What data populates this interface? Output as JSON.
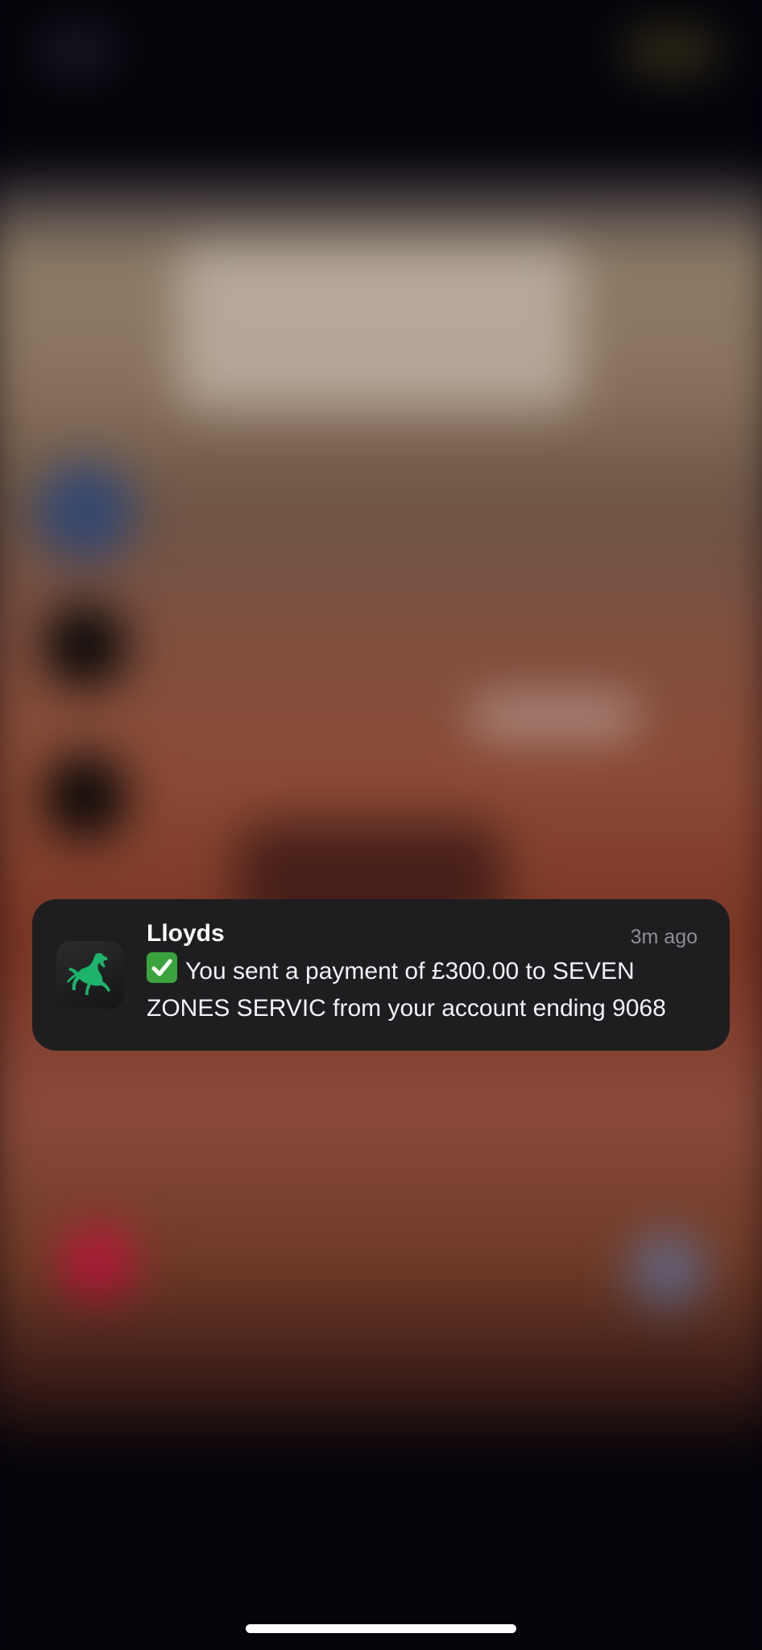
{
  "notification": {
    "app_name": "Lloyds",
    "time": "3m ago",
    "message": "You sent a payment of £300.00 to SEVEN ZONES SERVIC from your account ending 9068",
    "leading_icon": "check-mark-emoji",
    "app_icon": "lloyds-horse-icon"
  },
  "colors": {
    "card_background": "#1e1e21",
    "brand_green": "#1db36a",
    "check_green": "#3aa33d"
  }
}
